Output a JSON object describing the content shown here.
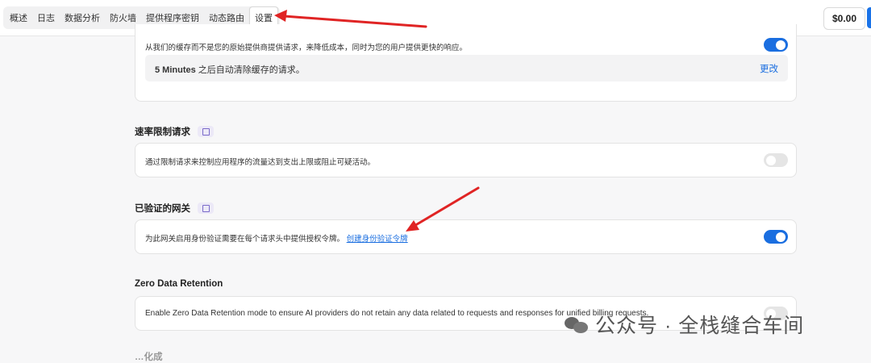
{
  "nav": {
    "tabs": [
      {
        "label": "概述"
      },
      {
        "label": "日志"
      },
      {
        "label": "数据分析"
      },
      {
        "label": "防火墙"
      },
      {
        "label": "提供程序密钥"
      },
      {
        "label": "动态路由"
      },
      {
        "label": "设置",
        "active": true
      }
    ]
  },
  "balance": "$0.00",
  "caching": {
    "description": "从我们的缓存而不是您的原始提供商提供请求，来降低成本，同时为您的用户提供更快的响应。",
    "enabled": true,
    "expiry_value": "5 Minutes",
    "expiry_suffix": " 之后自动清除缓存的请求。",
    "change_label": "更改"
  },
  "rate_limit": {
    "title": "速率限制请求",
    "description": "通过限制请求来控制应用程序的流量达到支出上限或阻止可疑活动。",
    "enabled": false
  },
  "auth_gateway": {
    "title": "已验证的网关",
    "description": "为此网关启用身份验证需要在每个请求头中提供授权令牌。",
    "link_label": "创建身份验证令牌",
    "enabled": true
  },
  "zdr": {
    "title": "Zero Data Retention",
    "description": "Enable Zero Data Retention mode to ensure AI providers do not retain any data related to requests and responses for unified billing requests.",
    "enabled": false
  },
  "next_section": {
    "title": "…化成"
  },
  "watermark": "公众号 · 全栈缝合车间",
  "colors": {
    "accent": "#1a6ee0",
    "annotation_arrow": "#e02424"
  }
}
